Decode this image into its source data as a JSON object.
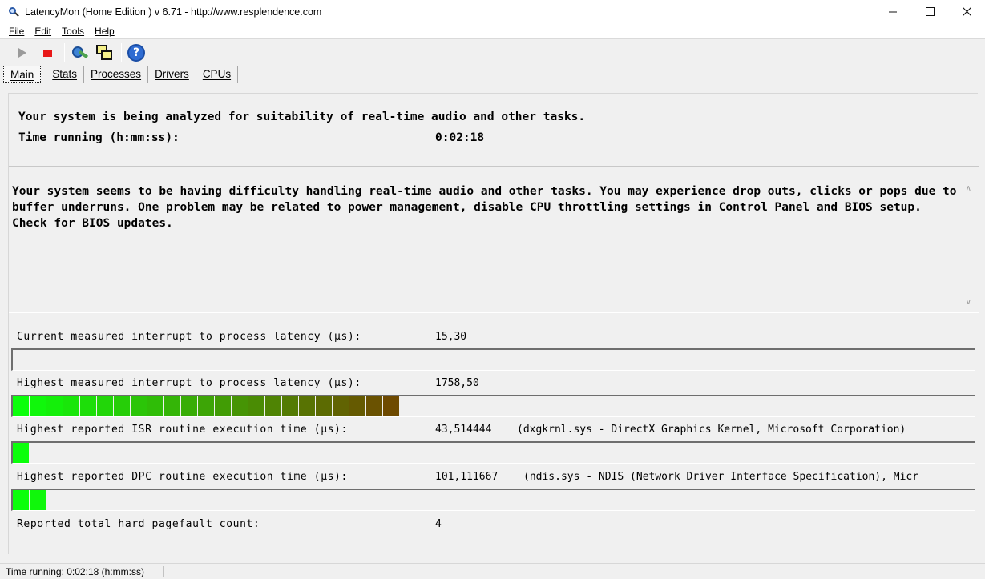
{
  "window": {
    "title": "LatencyMon  (Home Edition )  v 6.71 - http://www.resplendence.com",
    "icons": {
      "minimize": "minimize-icon",
      "maximize": "maximize-icon",
      "close": "close-icon"
    }
  },
  "menu": [
    "File",
    "Edit",
    "Tools",
    "Help"
  ],
  "toolbar": {
    "icons": [
      "play-icon",
      "stop-icon",
      "analyze-icon",
      "windows-icon",
      "help-icon"
    ],
    "help_glyph": "?"
  },
  "tabs": [
    "Main",
    "Stats",
    "Processes",
    "Drivers",
    "CPUs"
  ],
  "analysis": {
    "line1": "Your system is being analyzed for suitability of real-time audio and other tasks.",
    "time_label": "Time running (h:mm:ss):",
    "time_value": "0:02:18"
  },
  "conclusion": "Your system seems to be having difficulty handling real-time audio and other tasks. You may experience drop outs, clicks or pops due to buffer underruns. One problem may be related to power management, disable CPU throttling settings in Control Panel and BIOS setup. Check for BIOS updates.",
  "metrics": [
    {
      "label": "Current measured interrupt to process latency (µs):",
      "value": "15,30",
      "extra": "",
      "segments": 0
    },
    {
      "label": "Highest measured interrupt to process latency (µs):",
      "value": "1758,50",
      "extra": "",
      "segments": 23
    },
    {
      "label": "Highest reported ISR routine execution time (µs):",
      "value": "43,514444",
      "extra": "(dxgkrnl.sys - DirectX Graphics Kernel, Microsoft Corporation)",
      "segments": 1
    },
    {
      "label": "Highest reported DPC routine execution time (µs):",
      "value": "101,111667",
      "extra": "(ndis.sys - NDIS (Network Driver Interface Specification), Micr",
      "segments": 2
    }
  ],
  "pagefault": {
    "label": "Reported total hard pagefault count:",
    "value": "4"
  },
  "colors": {
    "bar_start": "#0bff0b",
    "bar_end": "#6e4a00"
  },
  "status": {
    "text": "Time running: 0:02:18  (h:mm:ss)"
  }
}
